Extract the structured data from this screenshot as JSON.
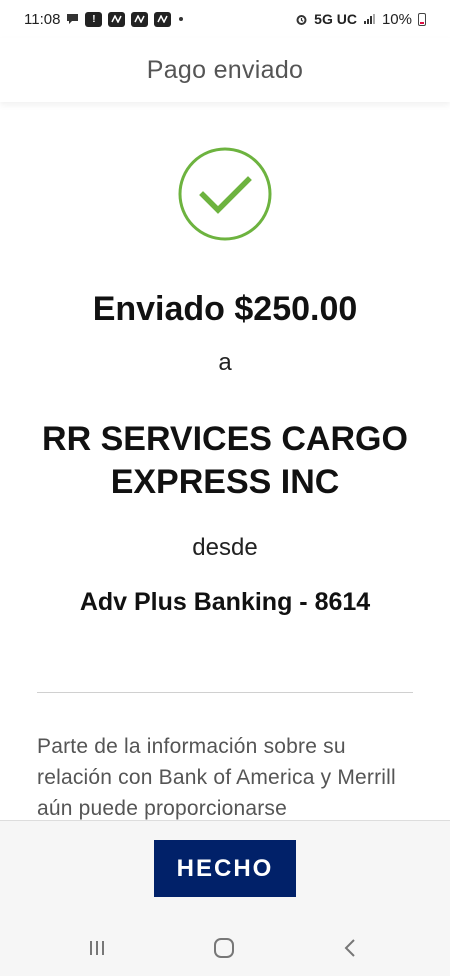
{
  "status_bar": {
    "time": "11:08",
    "network": "5G UC",
    "battery": "10%",
    "icons": [
      "chat-icon",
      "alert-icon",
      "app-icon",
      "app-icon",
      "app-icon",
      "alarm-icon",
      "signal-icon",
      "battery-icon"
    ]
  },
  "header": {
    "title": "Pago enviado"
  },
  "confirmation": {
    "icon": "checkmark-circle-icon",
    "amount_line": "Enviado $250.00",
    "to_word": "a",
    "recipient": "RR SERVICES CARGO EXPRESS INC",
    "from_word": "desde",
    "account": "Adv Plus Banking - 8614",
    "disclaimer": "Parte de la información sobre su relación con Bank of America y Merrill aún puede proporcionarse"
  },
  "actions": {
    "done_label": "HECHO"
  },
  "nav_bar": {
    "icons": [
      "recents-icon",
      "home-icon",
      "back-icon"
    ]
  },
  "colors": {
    "accent_green": "#6db33f",
    "button_navy": "#012169"
  }
}
